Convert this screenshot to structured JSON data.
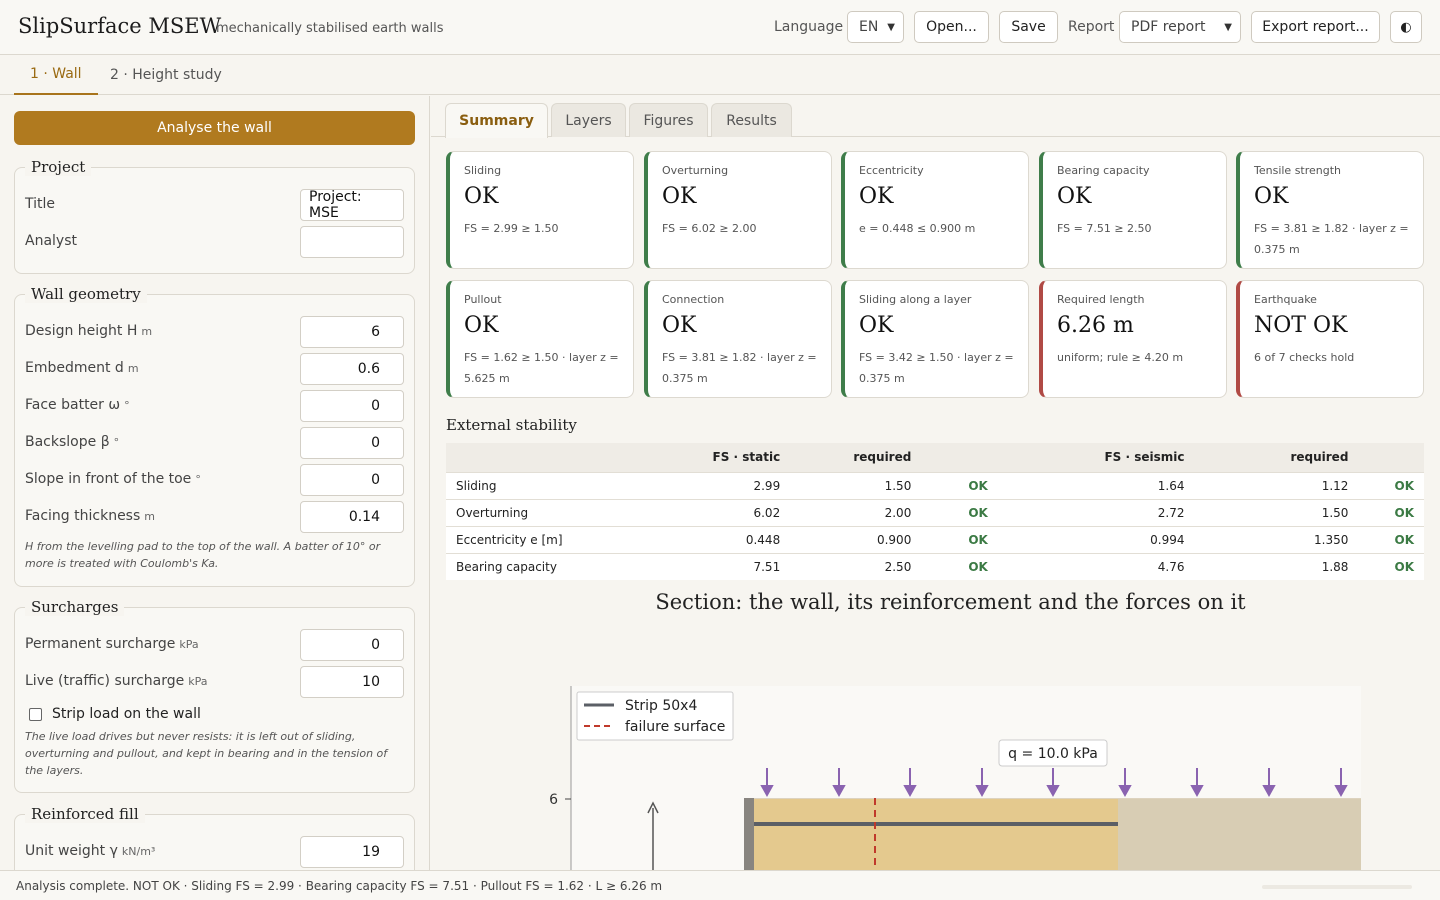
{
  "app": {
    "title": "SlipSurface MSEW",
    "subtitle": "mechanically stabilised earth walls"
  },
  "header": {
    "language_label": "Language",
    "language_value": "EN",
    "open_label": "Open...",
    "save_label": "Save",
    "report_label": "Report",
    "report_value": "PDF report",
    "export_label": "Export report...",
    "theme_icon": "◐"
  },
  "main_tabs": [
    "1 · Wall",
    "2 · Height study"
  ],
  "left": {
    "analyse_label": "Analyse the wall",
    "project": {
      "legend": "Project",
      "title_label": "Title",
      "title_value": "Project: MSE",
      "analyst_label": "Analyst",
      "analyst_value": ""
    },
    "geometry": {
      "legend": "Wall geometry",
      "fields": [
        {
          "label": "Design height H",
          "unit": "m",
          "value": "6"
        },
        {
          "label": "Embedment d",
          "unit": "m",
          "value": "0.6"
        },
        {
          "label": "Face batter ω",
          "unit": "°",
          "value": "0"
        },
        {
          "label": "Backslope β",
          "unit": "°",
          "value": "0"
        },
        {
          "label": "Slope in front of the toe",
          "unit": "°",
          "value": "0"
        },
        {
          "label": "Facing thickness",
          "unit": "m",
          "value": "0.14"
        }
      ],
      "note": "H from the levelling pad to the top of the wall. A batter of 10° or more is treated with Coulomb's Ka."
    },
    "surcharges": {
      "legend": "Surcharges",
      "fields": [
        {
          "label": "Permanent surcharge",
          "unit": "kPa",
          "value": "0"
        },
        {
          "label": "Live (traffic) surcharge",
          "unit": "kPa",
          "value": "10"
        }
      ],
      "strip_label": "Strip load on the wall",
      "note": "The live load drives but never resists: it is left out of sliding, overturning and pullout, and kept in bearing and in the tension of the layers."
    },
    "fill": {
      "legend": "Reinforced fill",
      "fields": [
        {
          "label": "Unit weight γ",
          "unit": "kN/m³",
          "value": "19"
        }
      ]
    }
  },
  "sub_tabs": [
    "Summary",
    "Layers",
    "Figures",
    "Results"
  ],
  "cards": [
    {
      "title": "Sliding",
      "value": "OK",
      "detail": "FS = 2.99 ≥ 1.50",
      "status": "ok"
    },
    {
      "title": "Overturning",
      "value": "OK",
      "detail": "FS = 6.02 ≥ 2.00",
      "status": "ok"
    },
    {
      "title": "Eccentricity",
      "value": "OK",
      "detail": "e = 0.448 ≤ 0.900 m",
      "status": "ok"
    },
    {
      "title": "Bearing capacity",
      "value": "OK",
      "detail": "FS = 7.51 ≥ 2.50",
      "status": "ok"
    },
    {
      "title": "Tensile strength",
      "value": "OK",
      "detail": "FS = 3.81 ≥ 1.82 · layer z = 0.375 m",
      "status": "ok"
    },
    {
      "title": "Pullout",
      "value": "OK",
      "detail": "FS = 1.62 ≥ 1.50 · layer z = 5.625 m",
      "status": "ok"
    },
    {
      "title": "Connection",
      "value": "OK",
      "detail": "FS = 3.81 ≥ 1.82 · layer z = 0.375 m",
      "status": "ok"
    },
    {
      "title": "Sliding along a layer",
      "value": "OK",
      "detail": "FS = 3.42 ≥ 1.50 · layer z = 0.375 m",
      "status": "ok"
    },
    {
      "title": "Required length",
      "value": "6.26 m",
      "detail": "uniform; rule ≥ 4.20 m",
      "status": "bad"
    },
    {
      "title": "Earthquake",
      "value": "NOT OK",
      "detail": "6 of 7 checks hold",
      "status": "bad"
    }
  ],
  "external": {
    "title": "External stability",
    "headers": [
      "",
      "FS · static",
      "required",
      "",
      "FS · seismic",
      "required",
      ""
    ],
    "rows": [
      [
        "Sliding",
        "2.99",
        "1.50",
        "OK",
        "1.64",
        "1.12",
        "OK"
      ],
      [
        "Overturning",
        "6.02",
        "2.00",
        "OK",
        "2.72",
        "1.50",
        "OK"
      ],
      [
        "Eccentricity e [m]",
        "0.448",
        "0.900",
        "OK",
        "0.994",
        "1.350",
        "OK"
      ],
      [
        "Bearing capacity",
        "7.51",
        "2.50",
        "OK",
        "4.76",
        "1.88",
        "OK"
      ]
    ]
  },
  "figure": {
    "title": "Section: the wall, its reinforcement and the forces on it",
    "legend": [
      "Strip 50x4",
      "failure surface"
    ],
    "load_label": "q = 10.0 kPa",
    "y_tick": "6"
  },
  "colors": {
    "accent": "#b07a1f",
    "ok": "#3f7d4a",
    "bad": "#b04a45",
    "fill": "#e4c98e",
    "retained": "#d8cdb4",
    "load": "#8a63b0"
  },
  "status": {
    "text": "Analysis complete. NOT OK · Sliding FS = 2.99 · Bearing capacity FS = 7.51 · Pullout FS = 1.62 · L ≥ 6.26 m"
  }
}
